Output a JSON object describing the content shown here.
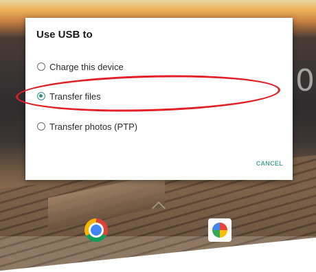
{
  "dialog": {
    "title": "Use USB to",
    "options": [
      {
        "label": "Charge this device",
        "selected": false
      },
      {
        "label": "Transfer files",
        "selected": true
      },
      {
        "label": "Transfer photos (PTP)",
        "selected": false
      }
    ],
    "cancel_label": "CANCEL"
  },
  "home": {
    "clock_partial": "0",
    "dock_icons": [
      "chrome-icon",
      "photos-icon"
    ]
  },
  "colors": {
    "accent": "#2f8f88",
    "annotation": "#e01f26"
  }
}
